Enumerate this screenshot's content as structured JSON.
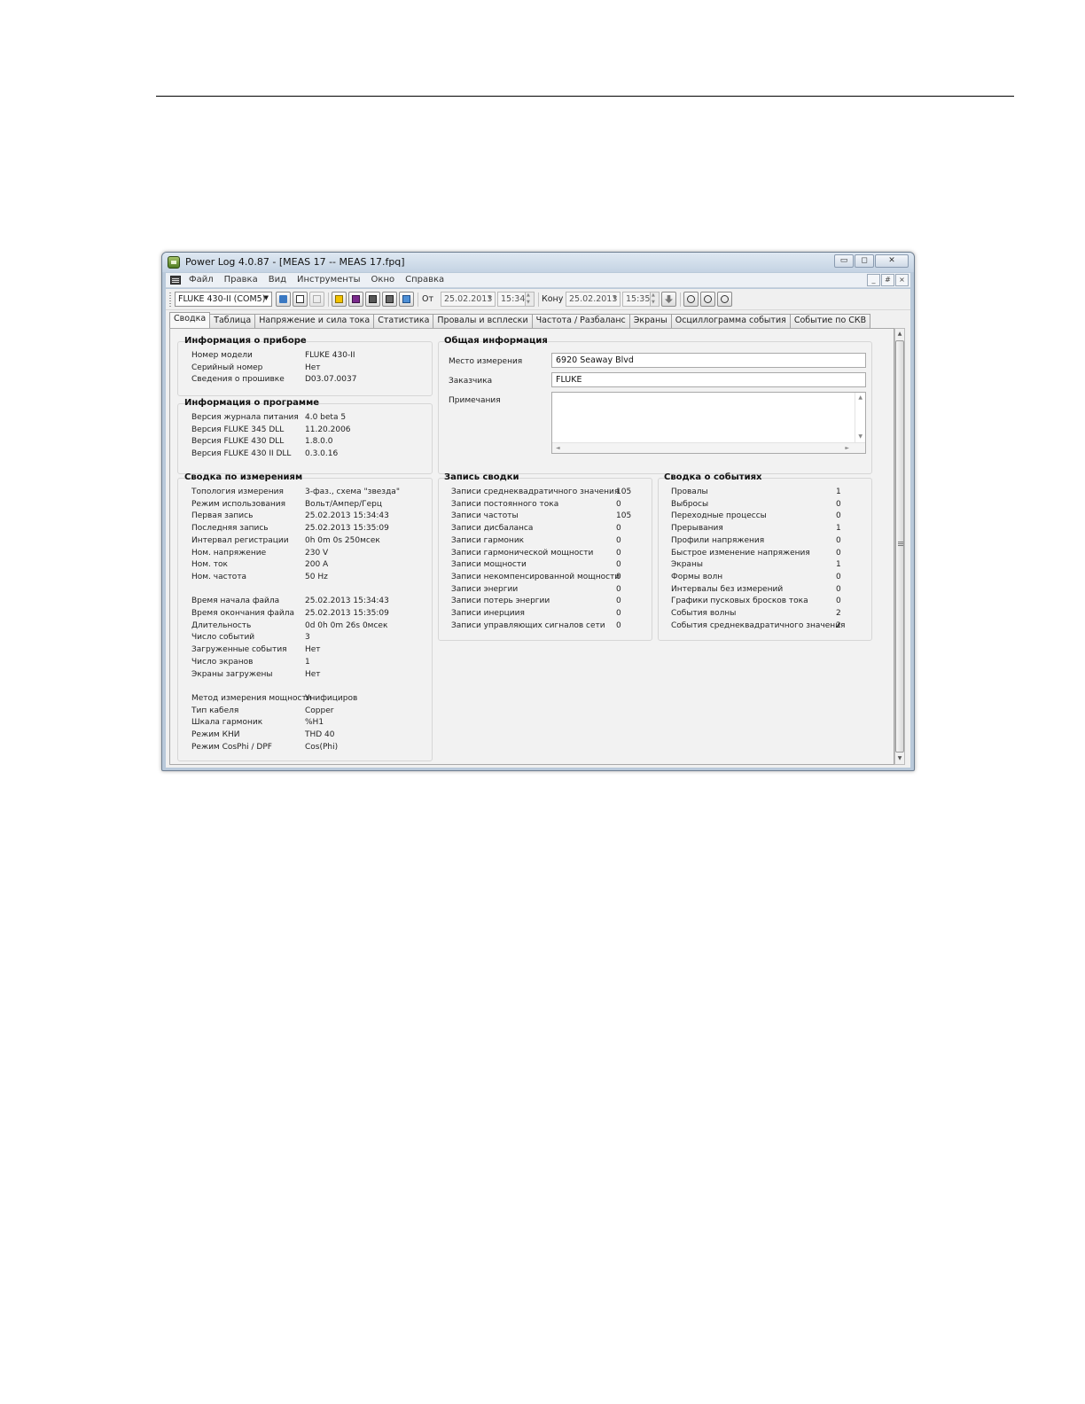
{
  "window": {
    "title": "Power Log 4.0.87 - [MEAS 17 -- MEAS 17.fpq]",
    "buttons": [
      "▭",
      "◻",
      "✕"
    ],
    "mdi_buttons": [
      "_",
      "#",
      "×"
    ]
  },
  "menu": [
    "Файл",
    "Правка",
    "Вид",
    "Инструменты",
    "Окно",
    "Справка"
  ],
  "toolbar": {
    "device": "FLUKE 430-II (COM5)",
    "from_label": "От",
    "from_date": "25.02.2013",
    "from_time": "15:34",
    "to_label": "Кону",
    "to_date": "25.02.2013",
    "to_time": "15:35"
  },
  "tabs": [
    "Сводка",
    "Таблица",
    "Напряжение и сила тока",
    "Статистика",
    "Провалы и всплески",
    "Частота / Разбаланс",
    "Экраны",
    "Осциллограмма события",
    "Событие по СКВ"
  ],
  "device_info": {
    "title": "Информация о приборе",
    "rows": [
      {
        "k": "Номер модели",
        "v": "FLUKE 430-II"
      },
      {
        "k": "Серийный номер",
        "v": "Нет"
      },
      {
        "k": "Сведения о прошивке",
        "v": "D03.07.0037"
      }
    ]
  },
  "program_info": {
    "title": "Информация о программе",
    "rows": [
      {
        "k": "Версия журнала питания",
        "v": "4.0 beta 5"
      },
      {
        "k": "Версия FLUKE 345 DLL",
        "v": "11.20.2006"
      },
      {
        "k": "Версия  FLUKE 430 DLL",
        "v": "1.8.0.0"
      },
      {
        "k": "Версия  FLUKE 430 II DLL",
        "v": "0.3.0.16"
      }
    ]
  },
  "general_info": {
    "title": "Общая информация",
    "location_label": "Место измерения",
    "location_value": "6920 Seaway Blvd",
    "customer_label": "Заказчика",
    "customer_value": "FLUKE",
    "notes_label": "Примечания",
    "notes_value": ""
  },
  "measurement_summary": {
    "title": "Сводка по измерениям",
    "rows": [
      {
        "k": "Топология измерения",
        "v": "3-фаз., схема \"звезда\""
      },
      {
        "k": "Режим использования",
        "v": "Вольт/Ампер/Герц"
      },
      {
        "k": "Первая запись",
        "v": "25.02.2013 15:34:43"
      },
      {
        "k": "Последняя запись",
        "v": "25.02.2013 15:35:09"
      },
      {
        "k": "Интервал регистрации",
        "v": "0h 0m 0s 250мсек"
      },
      {
        "k": "Ном. напряжение",
        "v": "230 V"
      },
      {
        "k": "Ном. ток",
        "v": "200 A"
      },
      {
        "k": "Ном. частота",
        "v": "50 Hz"
      },
      {
        "k": "Время начала файла",
        "v": "25.02.2013 15:34:43"
      },
      {
        "k": "Время окончания файла",
        "v": "25.02.2013 15:35:09"
      },
      {
        "k": "Длительность",
        "v": "0d 0h 0m 26s 0мсек"
      },
      {
        "k": "Число событий",
        "v": "3"
      },
      {
        "k": "Загруженные события",
        "v": "Нет"
      },
      {
        "k": "Число экранов",
        "v": "1"
      },
      {
        "k": "Экраны загружены",
        "v": "Нет"
      },
      {
        "k": "Метод измерения мощности",
        "v": "Унифициров"
      },
      {
        "k": "Тип кабеля",
        "v": "Copper"
      },
      {
        "k": "Шкала гармоник",
        "v": "%H1"
      },
      {
        "k": "Режим КНИ",
        "v": "THD 40"
      },
      {
        "k": "Режим CosPhi / DPF",
        "v": "Cos(Phi)"
      }
    ]
  },
  "record_summary": {
    "title": "Запись сводки",
    "rows": [
      {
        "k": "Записи среднеквадратичного значения",
        "v": "105"
      },
      {
        "k": "Записи постоянного тока",
        "v": "0"
      },
      {
        "k": "Записи частоты",
        "v": "105"
      },
      {
        "k": "Записи дисбаланса",
        "v": "0"
      },
      {
        "k": "Записи гармоник",
        "v": "0"
      },
      {
        "k": "Записи гармонической мощности",
        "v": "0"
      },
      {
        "k": "Записи мощности",
        "v": "0"
      },
      {
        "k": "Записи некомпенсированной мощности",
        "v": "0"
      },
      {
        "k": "Записи энергии",
        "v": "0"
      },
      {
        "k": "Записи потерь энергии",
        "v": "0"
      },
      {
        "k": "Записи инерциия",
        "v": "0"
      },
      {
        "k": "Записи управляющих сигналов сети",
        "v": "0"
      }
    ]
  },
  "event_summary": {
    "title": "Сводка о событиях",
    "rows": [
      {
        "k": "Провалы",
        "v": "1"
      },
      {
        "k": "Выбросы",
        "v": "0"
      },
      {
        "k": "Переходные процессы",
        "v": "0"
      },
      {
        "k": "Прерывания",
        "v": "1"
      },
      {
        "k": "Профили напряжения",
        "v": "0"
      },
      {
        "k": "Быстрое изменение напряжения",
        "v": "0"
      },
      {
        "k": "Экраны",
        "v": "1"
      },
      {
        "k": "Формы волн",
        "v": "0"
      },
      {
        "k": "Интервалы без измерений",
        "v": "0"
      },
      {
        "k": "Графики пусковых бросков тока",
        "v": "0"
      },
      {
        "k": "События волны",
        "v": "2"
      },
      {
        "k": "События среднеквадратичного значения",
        "v": "2"
      }
    ]
  },
  "colors": {
    "window_frame": "#b9c9da",
    "panel_bg": "#f2f2f2",
    "toolbar_icon_accent": "#f2c200"
  }
}
